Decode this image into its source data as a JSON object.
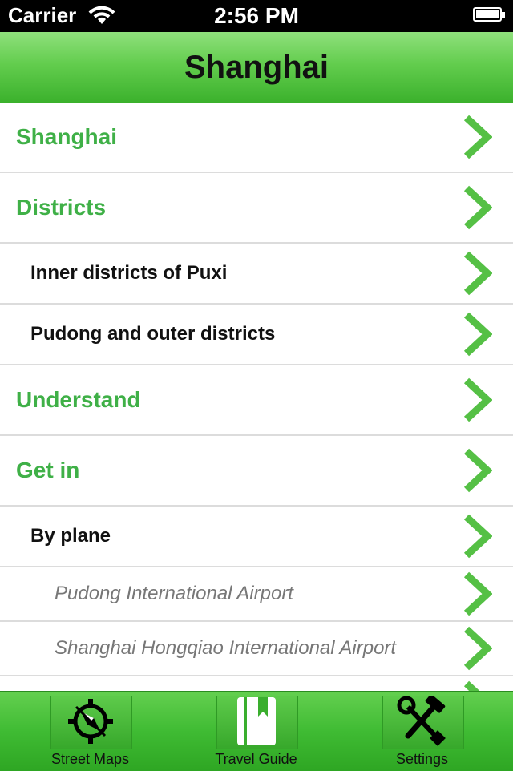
{
  "status_bar": {
    "carrier": "Carrier",
    "time": "2:56 PM"
  },
  "nav": {
    "title": "Shanghai"
  },
  "list": [
    {
      "level": 1,
      "label": "Shanghai"
    },
    {
      "level": 1,
      "label": "Districts"
    },
    {
      "level": 2,
      "label": "Inner districts of Puxi"
    },
    {
      "level": 2,
      "label": "Pudong and outer districts"
    },
    {
      "level": 1,
      "label": "Understand"
    },
    {
      "level": 1,
      "label": "Get in"
    },
    {
      "level": 2,
      "label": "By plane"
    },
    {
      "level": 3,
      "label": "Pudong International Airport"
    },
    {
      "level": 3,
      "label": "Shanghai Hongqiao International Airport"
    },
    {
      "level": 3,
      "label": ""
    }
  ],
  "tabs": [
    {
      "label": "Street Maps",
      "icon": "compass-icon"
    },
    {
      "label": "Travel Guide",
      "icon": "book-icon"
    },
    {
      "label": "Settings",
      "icon": "tools-icon"
    }
  ],
  "colors": {
    "accent_green": "#3fb047",
    "nav_green": "#63cd4e",
    "chevron_green": "#55c045"
  }
}
